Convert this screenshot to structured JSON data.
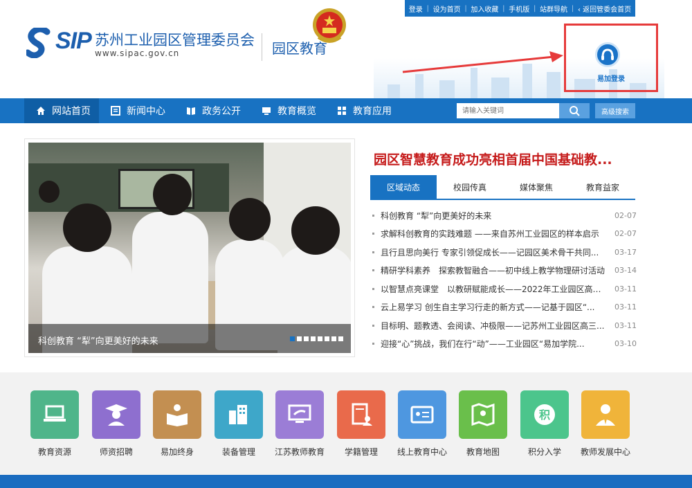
{
  "topbar": {
    "links": [
      "登录",
      "设为首页",
      "加入收藏",
      "手机版",
      "站群导航"
    ],
    "back": "返回管委会首页"
  },
  "logo": {
    "mark": "SIP",
    "name": "苏州工业园区管理委员会",
    "url": "www.sipac.gov.cn",
    "section": "园区教育"
  },
  "login": {
    "label": "易加登录"
  },
  "nav": {
    "items": [
      {
        "label": "网站首页",
        "icon": "home-icon"
      },
      {
        "label": "新闻中心",
        "icon": "news-icon"
      },
      {
        "label": "政务公开",
        "icon": "book-icon"
      },
      {
        "label": "教育概览",
        "icon": "monitor-icon"
      },
      {
        "label": "教育应用",
        "icon": "apps-icon"
      }
    ],
    "search_placeholder": "请输入关键词",
    "advanced_search": "高级搜索"
  },
  "slider": {
    "caption": "科创教育 “犁”向更美好的未来",
    "slide_count": 8,
    "active_slide": 1
  },
  "headline": "园区智慧教育成功亮相首届中国基础教...",
  "tabs": [
    "区域动态",
    "校园传真",
    "媒体聚焦",
    "教育益家"
  ],
  "news": [
    {
      "title": "科创教育 “犁”向更美好的未来",
      "date": "02-07"
    },
    {
      "title": "求解科创教育的实践难题 ——来自苏州工业园区的样本启示",
      "date": "02-07"
    },
    {
      "title": "且行且思向美行 专家引领促成长——记园区美术骨干共同...",
      "date": "03-17"
    },
    {
      "title": "精研学科素养　探索教智融合——初中线上教学物理研讨活动",
      "date": "03-14"
    },
    {
      "title": "以智慧点亮课堂　以教研赋能成长——2022年工业园区高中...",
      "date": "03-11"
    },
    {
      "title": "云上易学习 创生自主学习行走的新方式——记基于园区“...",
      "date": "03-11"
    },
    {
      "title": "目标明、题教透、会阅读、冲极限——记苏州工业园区高三...",
      "date": "03-11"
    },
    {
      "title": "迎接“心”挑战，我们在行“动”——工业园区“易加学院...",
      "date": "03-10"
    }
  ],
  "apps": [
    {
      "label": "教育资源",
      "color": "#4fb58a",
      "icon": "laptop-icon"
    },
    {
      "label": "师资招聘",
      "color": "#8e6fcf",
      "icon": "teacher-icon"
    },
    {
      "label": "易加终身",
      "color": "#c38f51",
      "icon": "reader-icon"
    },
    {
      "label": "装备管理",
      "color": "#3ea7c9",
      "icon": "building-icon"
    },
    {
      "label": "江苏教师教育",
      "color": "#9b7dd6",
      "icon": "screen-hand-icon"
    },
    {
      "label": "学籍管理",
      "color": "#e96a4b",
      "icon": "document-user-icon"
    },
    {
      "label": "线上教育中心",
      "color": "#4e97e0",
      "icon": "id-card-icon"
    },
    {
      "label": "教育地图",
      "color": "#6abf4b",
      "icon": "map-icon"
    },
    {
      "label": "积分入学",
      "color": "#4cc58c",
      "icon": "points-icon"
    },
    {
      "label": "教师发展中心",
      "color": "#f0b43a",
      "icon": "person-tie-icon"
    }
  ]
}
